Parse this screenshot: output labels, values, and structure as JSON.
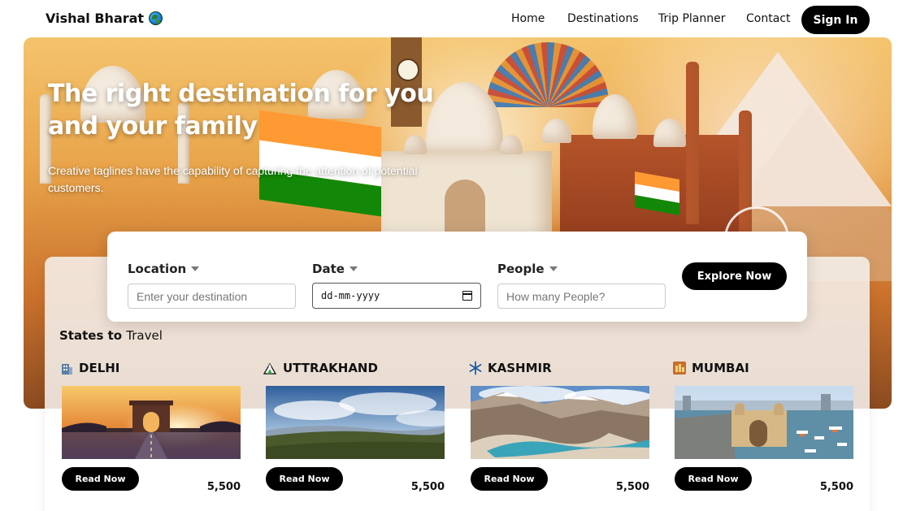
{
  "nav": {
    "brand": "Vishal Bharat",
    "brand_icon": "globe-icon",
    "links": [
      "Home",
      "Destinations",
      "Trip Planner",
      "Contact"
    ],
    "signin_label": "Sign In"
  },
  "hero": {
    "title": "The right destination for you and your family",
    "subtitle": "Creative taglines have the capability of capturing the attention of potential customers."
  },
  "search": {
    "location": {
      "label": "Location",
      "placeholder": "Enter your destination"
    },
    "date": {
      "label": "Date",
      "value": "dd-mm-yyyy"
    },
    "people": {
      "label": "People",
      "placeholder": "How many People?"
    },
    "explore_label": "Explore Now"
  },
  "states": {
    "title_prefix": "States to ",
    "title_accent": "Travel",
    "read_label": "Read Now",
    "cards": [
      {
        "name": "DELHI",
        "icon": "building-icon",
        "price": "5,500"
      },
      {
        "name": "UTTRAKHAND",
        "icon": "mountain-icon",
        "price": "5,500"
      },
      {
        "name": "KASHMIR",
        "icon": "snowflake-icon",
        "price": "5,500"
      },
      {
        "name": "MUMBAI",
        "icon": "city-icon",
        "price": "5,500"
      }
    ]
  },
  "colors": {
    "primary_button": "#000000",
    "hero_sky": "#f4c46d",
    "card_panel": "#f5f0ec"
  }
}
